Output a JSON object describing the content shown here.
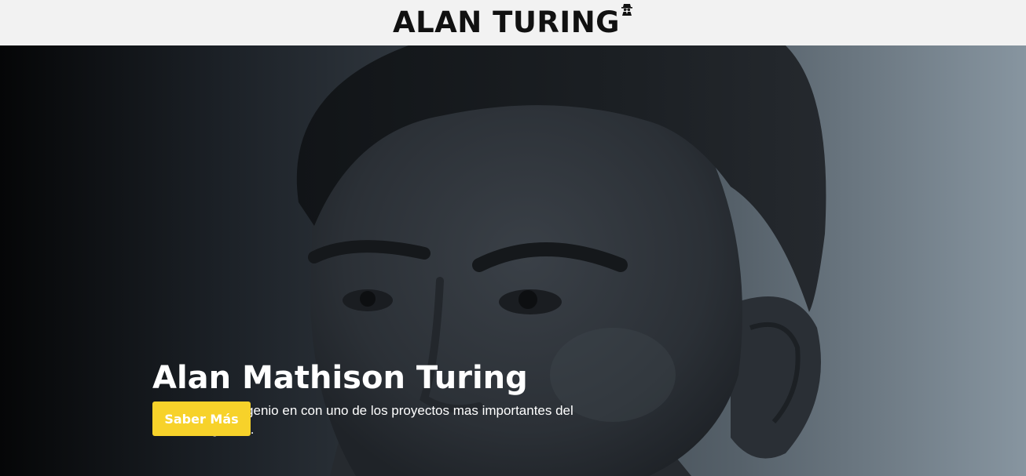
{
  "header": {
    "title": "ALAN TURING",
    "icon": "spy-icon",
    "background": "#f2f2f2"
  },
  "hero": {
    "image": "alan-turing-portrait",
    "title": "Alan Mathison Turing",
    "description": "Un matematico genio en con uno de los proyectos mas importantes del anterior siglo XX.",
    "cta_label": "Saber Más",
    "cta_color": "#f7d22a"
  }
}
